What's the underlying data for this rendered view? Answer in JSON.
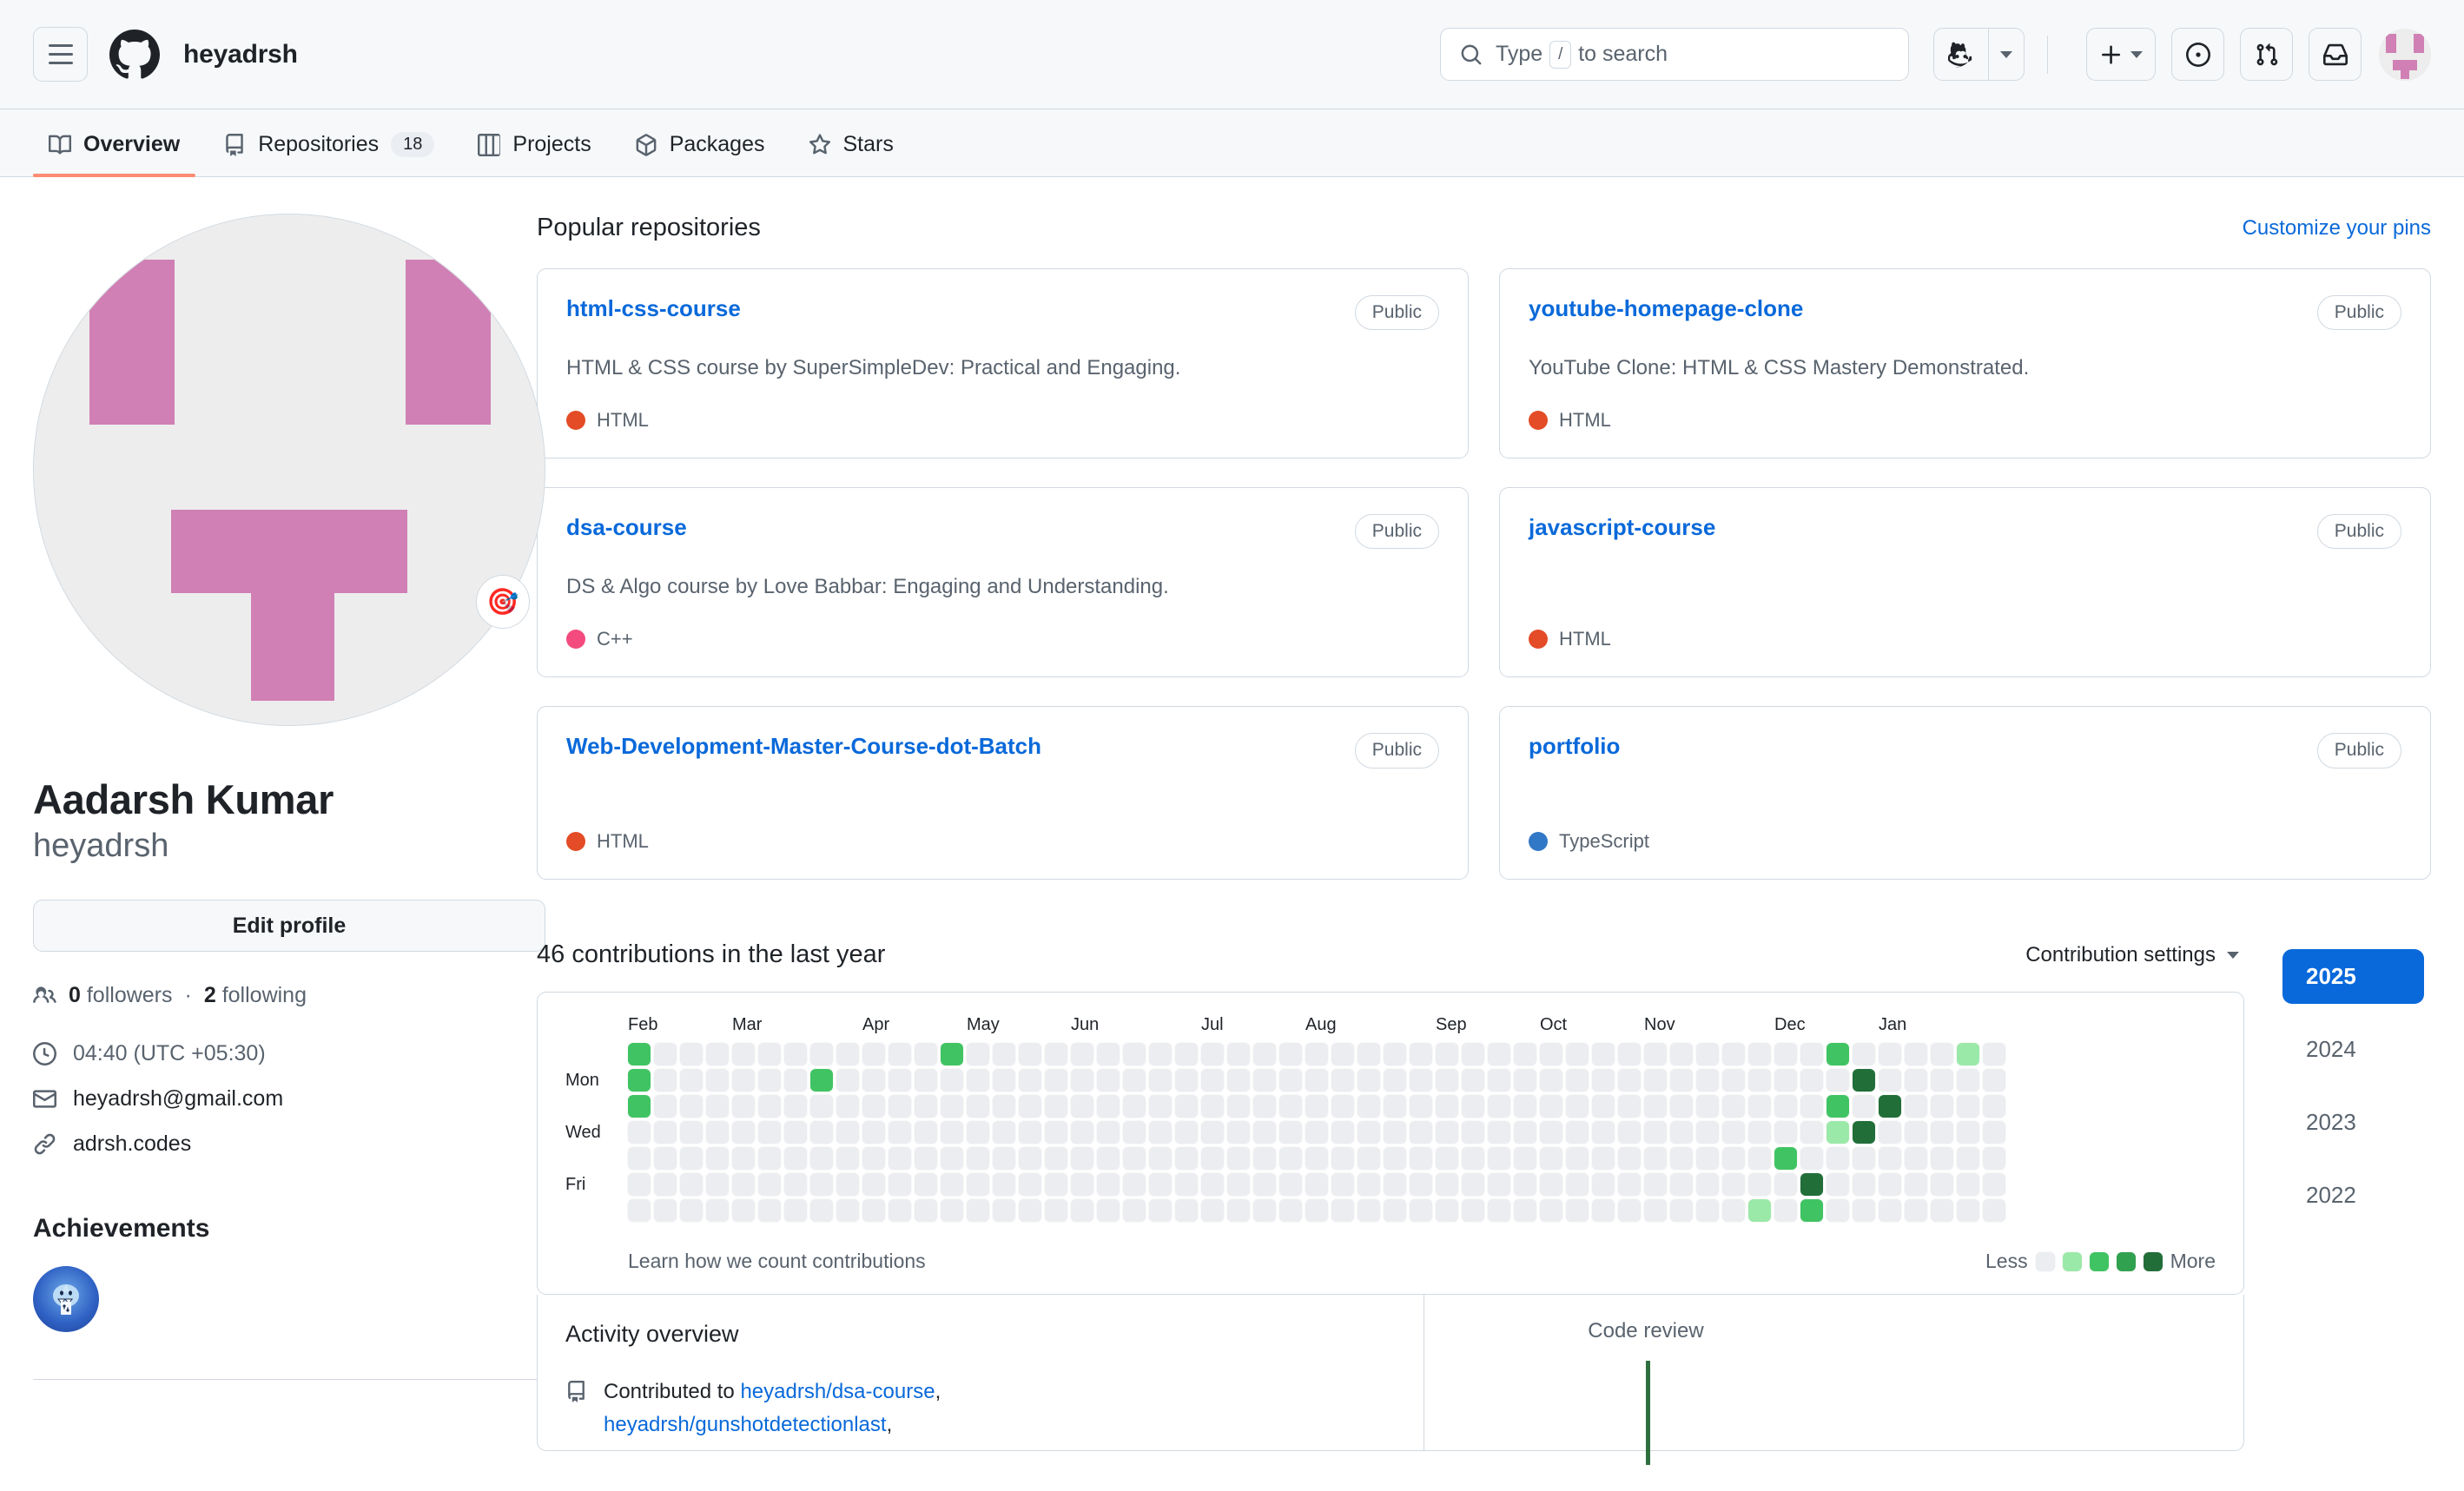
{
  "header": {
    "owner": "heyadrsh",
    "menu_icon": "hamburger-icon",
    "logo_icon": "github-logo-icon",
    "search": {
      "placeholder_pre": "Type",
      "slash": "/",
      "placeholder_post": "to search"
    },
    "copilot_label": "copilot-icon",
    "create_label": "plus-icon",
    "issues_label": "issues-icon",
    "pulls_label": "pull-requests-icon",
    "inbox_label": "inbox-icon",
    "avatar_label": "user-avatar"
  },
  "nav": {
    "tabs": [
      {
        "label": "Overview",
        "icon": "book-icon",
        "count": null,
        "active": true
      },
      {
        "label": "Repositories",
        "icon": "repo-icon",
        "count": "18",
        "active": false
      },
      {
        "label": "Projects",
        "icon": "project-icon",
        "count": null,
        "active": false
      },
      {
        "label": "Packages",
        "icon": "package-icon",
        "count": null,
        "active": false
      },
      {
        "label": "Stars",
        "icon": "star-icon",
        "count": null,
        "active": false
      }
    ]
  },
  "profile": {
    "status_emoji": "🎯",
    "fullname": "Aadarsh Kumar",
    "username": "heyadrsh",
    "edit_button": "Edit profile",
    "followers_count": "0",
    "followers_label": "followers",
    "separator": "·",
    "following_count": "2",
    "following_label": "following",
    "local_time": "04:40 (UTC +05:30)",
    "email": "heyadrsh@gmail.com",
    "website": "adrsh.codes",
    "achievements_title": "Achievements",
    "achievement_badges": [
      {
        "name": "pull-shark-badge"
      }
    ]
  },
  "repositories": {
    "section_title": "Popular repositories",
    "customize_link": "Customize your pins",
    "items": [
      {
        "name": "html-css-course",
        "visibility": "Public",
        "description": "HTML & CSS course by SuperSimpleDev: Practical and Engaging.",
        "language": "HTML",
        "language_color": "#e34c26"
      },
      {
        "name": "youtube-homepage-clone",
        "visibility": "Public",
        "description": "YouTube Clone: HTML & CSS Mastery Demonstrated.",
        "language": "HTML",
        "language_color": "#e34c26"
      },
      {
        "name": "dsa-course",
        "visibility": "Public",
        "description": "DS & Algo course by Love Babbar: Engaging and Understanding.",
        "language": "C++",
        "language_color": "#f34b7d"
      },
      {
        "name": "javascript-course",
        "visibility": "Public",
        "description": "",
        "language": "HTML",
        "language_color": "#e34c26"
      },
      {
        "name": "Web-Development-Master-Course-dot-Batch",
        "visibility": "Public",
        "description": "",
        "language": "HTML",
        "language_color": "#e34c26"
      },
      {
        "name": "portfolio",
        "visibility": "Public",
        "description": "",
        "language": "TypeScript",
        "language_color": "#3178c6"
      }
    ]
  },
  "contributions": {
    "title": "46 contributions in the last year",
    "settings_label": "Contribution settings",
    "learn_link": "Learn how we count contributions",
    "legend_less": "Less",
    "legend_more": "More",
    "years": [
      {
        "label": "2025",
        "active": true
      },
      {
        "label": "2024",
        "active": false
      },
      {
        "label": "2023",
        "active": false
      },
      {
        "label": "2022",
        "active": false
      }
    ]
  },
  "activity": {
    "title": "Activity overview",
    "contributed_prefix": "Contributed to",
    "repos": [
      "heyadrsh/dsa-course",
      "heyadrsh/gunshotdetectionlast"
    ],
    "code_review_label": "Code review"
  },
  "chart_data": {
    "type": "heatmap",
    "title": "46 contributions in the last year",
    "months": [
      "Feb",
      "Mar",
      "Apr",
      "May",
      "Jun",
      "Jul",
      "Aug",
      "Sep",
      "Oct",
      "Nov",
      "Dec",
      "Jan"
    ],
    "month_week_index": [
      0,
      4,
      9,
      13,
      17,
      22,
      26,
      31,
      35,
      39,
      44,
      48
    ],
    "day_labels": [
      "",
      "Mon",
      "",
      "Wed",
      "",
      "Fri",
      ""
    ],
    "weeks": 53,
    "levels": 5,
    "level_colors": [
      "#ebedf0",
      "#9be9a8",
      "#40c463",
      "#30a14e",
      "#216e39"
    ],
    "cells": [
      {
        "week": 0,
        "day": 0,
        "level": 2
      },
      {
        "week": 0,
        "day": 1,
        "level": 2
      },
      {
        "week": 0,
        "day": 2,
        "level": 2
      },
      {
        "week": 7,
        "day": 1,
        "level": 2
      },
      {
        "week": 12,
        "day": 0,
        "level": 2
      },
      {
        "week": 43,
        "day": 6,
        "level": 1
      },
      {
        "week": 44,
        "day": 4,
        "level": 2
      },
      {
        "week": 45,
        "day": 5,
        "level": 4
      },
      {
        "week": 45,
        "day": 6,
        "level": 2
      },
      {
        "week": 46,
        "day": 0,
        "level": 2
      },
      {
        "week": 46,
        "day": 2,
        "level": 2
      },
      {
        "week": 46,
        "day": 3,
        "level": 1
      },
      {
        "week": 47,
        "day": 1,
        "level": 4
      },
      {
        "week": 47,
        "day": 3,
        "level": 4
      },
      {
        "week": 48,
        "day": 2,
        "level": 4
      },
      {
        "week": 51,
        "day": 0,
        "level": 1
      }
    ]
  }
}
